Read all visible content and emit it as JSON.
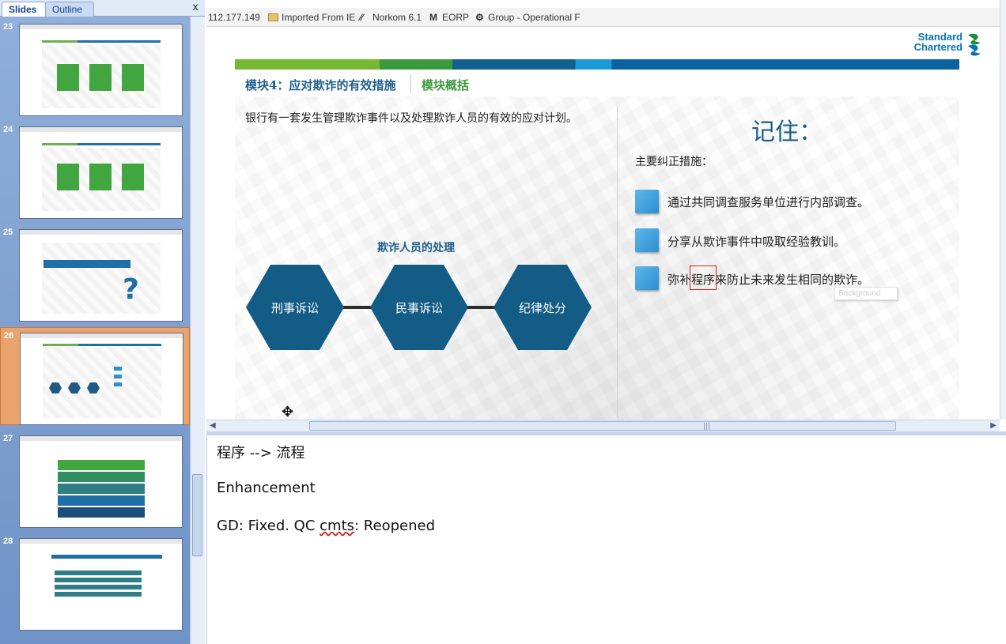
{
  "pane_tabs": {
    "slides": "Slides",
    "outline": "Outline",
    "close": "x"
  },
  "thumbnails": [
    {
      "number": "23",
      "selected": false
    },
    {
      "number": "24",
      "selected": false
    },
    {
      "number": "25",
      "selected": false
    },
    {
      "number": "26",
      "selected": true
    },
    {
      "number": "27",
      "selected": false
    },
    {
      "number": "28",
      "selected": false
    }
  ],
  "browser_bar": {
    "address_fragment": "112.177.149",
    "bookmarks": [
      "Imported From IE",
      "Norkom 6.1",
      "EORP",
      "Group - Operational F"
    ]
  },
  "logo": {
    "line1": "Standard",
    "line2": "Chartered"
  },
  "slide": {
    "module_title": "模块4：应对欺诈的有效措施",
    "module_overview": "模块概括",
    "intro_text": "银行有一套发生管理欺诈事件以及处理欺诈人员的有效的应对计划。",
    "handling_title": "欺诈人员的处理",
    "hexagons": [
      "刑事诉讼",
      "民事诉讼",
      "纪律处分"
    ],
    "remember_title": "记住：",
    "measures_title": "主要纠正措施：",
    "measures": [
      "通过共同调查服务单位进行内部调查。",
      "分享从欺诈事件中吸取经验教训。",
      "弥补程序来防止未来发生相同的欺诈。"
    ],
    "tooltip": "Background"
  },
  "notes": {
    "line1": "程序 --> 流程",
    "line2": "Enhancement",
    "line3_prefix": "GD: Fixed. QC ",
    "line3_misspelled": "cmts",
    "line3_suffix": ": Reopened"
  },
  "colors": {
    "brand_blue": "#0473ba",
    "hex_blue": "#125c85",
    "title_blue": "#1d5d8c",
    "overview_green": "#3c9a3c",
    "selected_thumb": "#e9a36b"
  }
}
